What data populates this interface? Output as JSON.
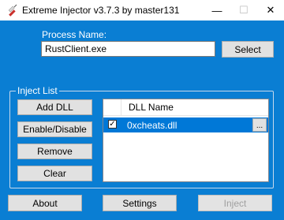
{
  "window": {
    "title": "Extreme Injector v3.7.3 by master131",
    "controls": {
      "minimize": "—",
      "maximize": "☐",
      "close": "✕"
    }
  },
  "process": {
    "label": "Process Name:",
    "value": "RustClient.exe",
    "select_label": "Select"
  },
  "inject_list": {
    "label": "Inject List",
    "buttons": {
      "add_dll": "Add DLL",
      "enable_disable": "Enable/Disable",
      "remove": "Remove",
      "clear": "Clear"
    },
    "column_header": "DLL Name",
    "items": [
      {
        "checked": true,
        "name": "0xcheats.dll",
        "browse_label": "..."
      }
    ]
  },
  "footer": {
    "about": "About",
    "settings": "Settings",
    "inject": "Inject"
  },
  "colors": {
    "background": "#0a7ed3",
    "selection": "#0078d7"
  }
}
